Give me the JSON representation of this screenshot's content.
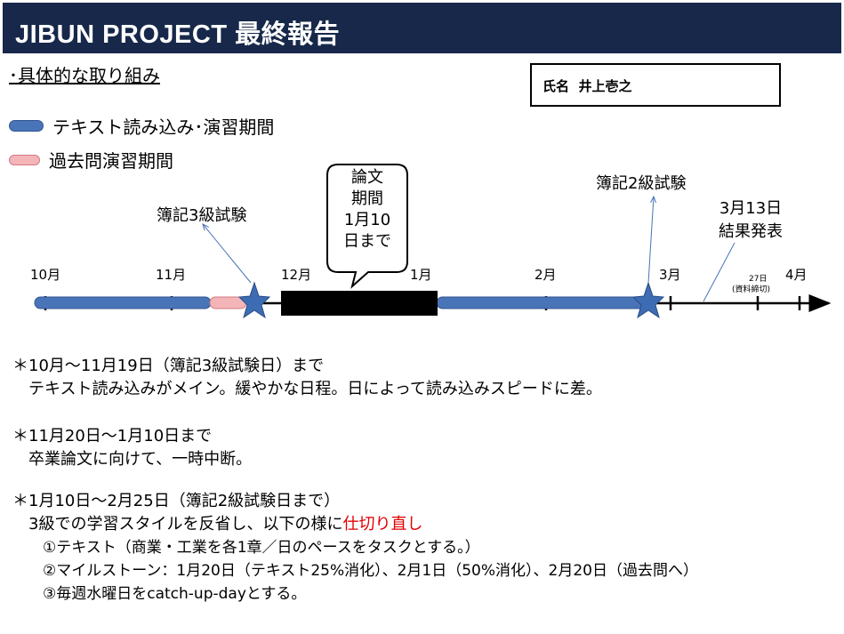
{
  "header": {
    "title": "JIBUN PROJECT 最終報告",
    "subtitle": "･具体的な取り組み",
    "name_label": "氏名",
    "name_value": "井上壱之"
  },
  "legend": {
    "study_label": "テキスト読み込み･演習期間",
    "past_exam_label": "過去問演習期間"
  },
  "timeline": {
    "months": [
      "10月",
      "11月",
      "12月",
      "1月",
      "2月",
      "3月",
      "4月"
    ],
    "deadline_day": "27日",
    "deadline_note": "(資料締切)",
    "exam3_label": "簿記3級試験",
    "exam2_label": "簿記2級試験",
    "thesis_bubble": [
      "論文",
      "期間",
      "1月10",
      "日まで"
    ],
    "result_lines": [
      "3月13日",
      "結果発表"
    ]
  },
  "notes": {
    "item1_title": "＊10月～11月19日（簿記3級試験日）まで",
    "item1_body": "テキスト読み込みがメイン。緩やかな日程。日によって読み込みスピードに差。",
    "item2_title": "＊11月20日～1月10日まで",
    "item2_body": "卒業論文に向けて、一時中断。",
    "item3_title": "＊1月10日～2月25日（簿記2級試験日まで）",
    "item3_body_prefix": "3級での学習スタイルを反省し、以下の様に",
    "item3_body_highlight": "仕切り直し",
    "item3_step1": "①テキスト（商業・工業を各1章／日のペースをタスクとする。）",
    "item3_step2": "②マイルストーン：1月20日（テキスト25%消化）、2月1日（50%消化）、2月20日（過去問へ）",
    "item3_step3": "③毎週水曜日をcatch-up-dayとする。"
  },
  "colors": {
    "title_bar": "#17284a",
    "study_period": "#4a74b8",
    "past_exam_period": "#f3b5b8",
    "thesis_block": "#000000",
    "star": "#3d6cb3",
    "highlight": "#e00000"
  }
}
